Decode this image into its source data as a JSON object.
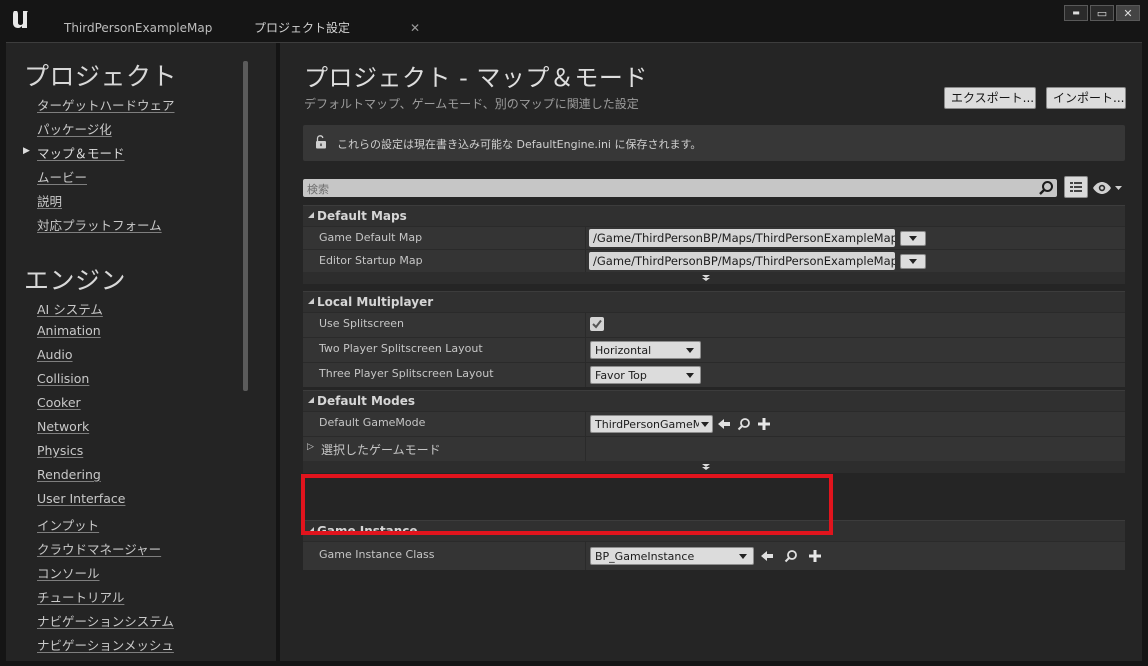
{
  "tabs": [
    {
      "label": "ThirdPersonExampleMap"
    },
    {
      "label": "プロジェクト設定"
    }
  ],
  "window_controls": {
    "minimize": "▬",
    "maximize": "▭",
    "close": "✕"
  },
  "sidebar": {
    "project_title": "プロジェクト",
    "project_items": [
      {
        "label": "ターゲットハードウェア"
      },
      {
        "label": "パッケージ化"
      },
      {
        "label": "マップ＆モード"
      },
      {
        "label": "ムービー"
      },
      {
        "label": "説明"
      },
      {
        "label": "対応プラットフォーム"
      }
    ],
    "engine_title": "エンジン",
    "engine_items": [
      {
        "label": "AI システム"
      },
      {
        "label": "Animation"
      },
      {
        "label": "Audio"
      },
      {
        "label": "Collision"
      },
      {
        "label": "Cooker"
      },
      {
        "label": "Network"
      },
      {
        "label": "Physics"
      },
      {
        "label": "Rendering"
      },
      {
        "label": "User Interface"
      },
      {
        "label": "インプット"
      },
      {
        "label": "クラウドマネージャー"
      },
      {
        "label": "コンソール"
      },
      {
        "label": "チュートリアル"
      },
      {
        "label": "ナビゲーションシステム"
      },
      {
        "label": "ナビゲーションメッシュ"
      }
    ]
  },
  "header": {
    "title": "プロジェクト - マップ＆モード",
    "subtitle": "デフォルトマップ、ゲームモード、別のマップに関連した設定",
    "export_label": "エクスポート...",
    "import_label": "インポート..."
  },
  "notice": {
    "text": "これらの設定は現在書き込み可能な DefaultEngine.ini に保存されます。"
  },
  "search": {
    "placeholder": "検索"
  },
  "categories": {
    "default_maps": {
      "title": "Default Maps",
      "game_default_map_label": "Game Default Map",
      "game_default_map_value": "/Game/ThirdPersonBP/Maps/ThirdPersonExampleMap",
      "editor_startup_map_label": "Editor Startup Map",
      "editor_startup_map_value": "/Game/ThirdPersonBP/Maps/ThirdPersonExampleMap"
    },
    "local_multiplayer": {
      "title": "Local Multiplayer",
      "use_splitscreen_label": "Use Splitscreen",
      "use_splitscreen_checked": true,
      "two_player_label": "Two Player Splitscreen Layout",
      "two_player_value": "Horizontal",
      "three_player_label": "Three Player Splitscreen Layout",
      "three_player_value": "Favor Top"
    },
    "default_modes": {
      "title": "Default Modes",
      "default_gamemode_label": "Default GameMode",
      "default_gamemode_value": "ThirdPersonGameMode",
      "selected_gamemode_label": "選択したゲームモード"
    },
    "game_instance": {
      "title": "Game Instance",
      "class_label": "Game Instance Class",
      "class_value": "BP_GameInstance"
    }
  },
  "colors": {
    "highlight": "#e1141d",
    "panel_bg": "#252525",
    "field_bg": "#d6d6d6"
  }
}
